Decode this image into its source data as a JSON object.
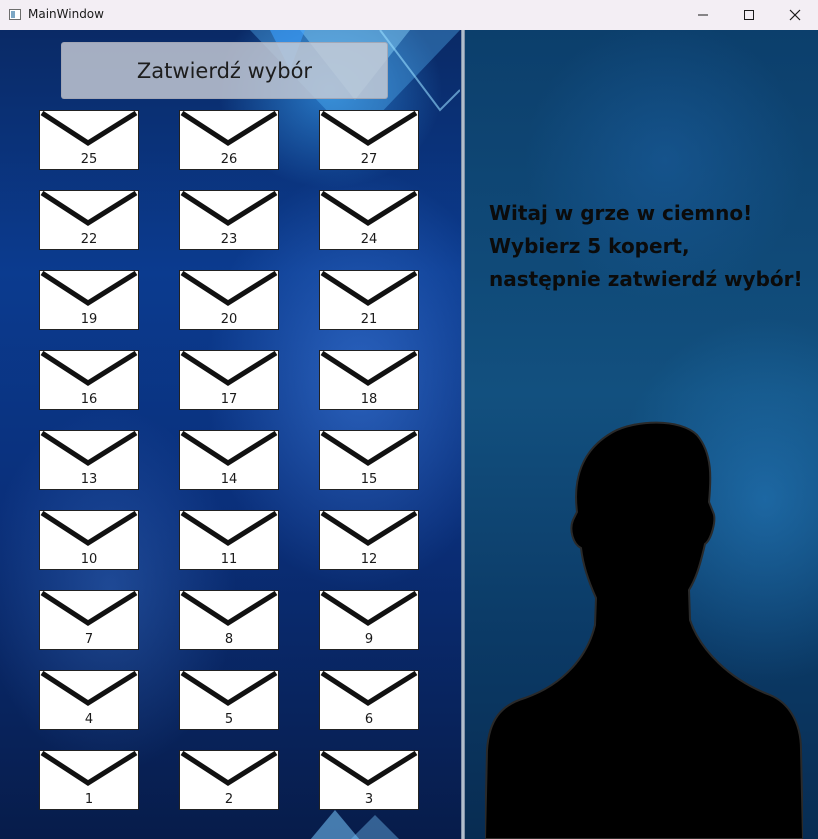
{
  "window": {
    "title": "MainWindow",
    "controls": {
      "minimize_icon": "minimize-icon",
      "maximize_icon": "maximize-icon",
      "close_icon": "close-icon"
    }
  },
  "game": {
    "confirm_label": "Zatwierdź wybór",
    "envelope_rows": [
      [
        "25",
        "26",
        "27"
      ],
      [
        "22",
        "23",
        "24"
      ],
      [
        "19",
        "20",
        "21"
      ],
      [
        "16",
        "17",
        "18"
      ],
      [
        "13",
        "14",
        "15"
      ],
      [
        "10",
        "11",
        "12"
      ],
      [
        "7",
        "8",
        "9"
      ],
      [
        "4",
        "5",
        "6"
      ],
      [
        "1",
        "2",
        "3"
      ]
    ],
    "welcome": [
      "Witaj w grze w ciemno!",
      "Wybierz 5 kopert,",
      "następnie zatwierdź wybór!"
    ]
  },
  "colors": {
    "left_background": "#0b3b8f",
    "right_background": "#12507f",
    "welcome_text": "#0b0b0b"
  }
}
